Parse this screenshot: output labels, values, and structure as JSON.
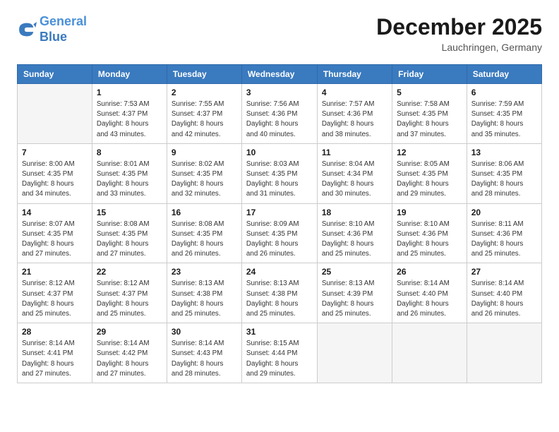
{
  "header": {
    "logo_line1": "General",
    "logo_line2": "Blue",
    "month_title": "December 2025",
    "location": "Lauchringen, Germany"
  },
  "weekdays": [
    "Sunday",
    "Monday",
    "Tuesday",
    "Wednesday",
    "Thursday",
    "Friday",
    "Saturday"
  ],
  "weeks": [
    [
      {
        "day": "",
        "info": ""
      },
      {
        "day": "1",
        "info": "Sunrise: 7:53 AM\nSunset: 4:37 PM\nDaylight: 8 hours\nand 43 minutes."
      },
      {
        "day": "2",
        "info": "Sunrise: 7:55 AM\nSunset: 4:37 PM\nDaylight: 8 hours\nand 42 minutes."
      },
      {
        "day": "3",
        "info": "Sunrise: 7:56 AM\nSunset: 4:36 PM\nDaylight: 8 hours\nand 40 minutes."
      },
      {
        "day": "4",
        "info": "Sunrise: 7:57 AM\nSunset: 4:36 PM\nDaylight: 8 hours\nand 38 minutes."
      },
      {
        "day": "5",
        "info": "Sunrise: 7:58 AM\nSunset: 4:35 PM\nDaylight: 8 hours\nand 37 minutes."
      },
      {
        "day": "6",
        "info": "Sunrise: 7:59 AM\nSunset: 4:35 PM\nDaylight: 8 hours\nand 35 minutes."
      }
    ],
    [
      {
        "day": "7",
        "info": "Sunrise: 8:00 AM\nSunset: 4:35 PM\nDaylight: 8 hours\nand 34 minutes."
      },
      {
        "day": "8",
        "info": "Sunrise: 8:01 AM\nSunset: 4:35 PM\nDaylight: 8 hours\nand 33 minutes."
      },
      {
        "day": "9",
        "info": "Sunrise: 8:02 AM\nSunset: 4:35 PM\nDaylight: 8 hours\nand 32 minutes."
      },
      {
        "day": "10",
        "info": "Sunrise: 8:03 AM\nSunset: 4:35 PM\nDaylight: 8 hours\nand 31 minutes."
      },
      {
        "day": "11",
        "info": "Sunrise: 8:04 AM\nSunset: 4:34 PM\nDaylight: 8 hours\nand 30 minutes."
      },
      {
        "day": "12",
        "info": "Sunrise: 8:05 AM\nSunset: 4:35 PM\nDaylight: 8 hours\nand 29 minutes."
      },
      {
        "day": "13",
        "info": "Sunrise: 8:06 AM\nSunset: 4:35 PM\nDaylight: 8 hours\nand 28 minutes."
      }
    ],
    [
      {
        "day": "14",
        "info": "Sunrise: 8:07 AM\nSunset: 4:35 PM\nDaylight: 8 hours\nand 27 minutes."
      },
      {
        "day": "15",
        "info": "Sunrise: 8:08 AM\nSunset: 4:35 PM\nDaylight: 8 hours\nand 27 minutes."
      },
      {
        "day": "16",
        "info": "Sunrise: 8:08 AM\nSunset: 4:35 PM\nDaylight: 8 hours\nand 26 minutes."
      },
      {
        "day": "17",
        "info": "Sunrise: 8:09 AM\nSunset: 4:35 PM\nDaylight: 8 hours\nand 26 minutes."
      },
      {
        "day": "18",
        "info": "Sunrise: 8:10 AM\nSunset: 4:36 PM\nDaylight: 8 hours\nand 25 minutes."
      },
      {
        "day": "19",
        "info": "Sunrise: 8:10 AM\nSunset: 4:36 PM\nDaylight: 8 hours\nand 25 minutes."
      },
      {
        "day": "20",
        "info": "Sunrise: 8:11 AM\nSunset: 4:36 PM\nDaylight: 8 hours\nand 25 minutes."
      }
    ],
    [
      {
        "day": "21",
        "info": "Sunrise: 8:12 AM\nSunset: 4:37 PM\nDaylight: 8 hours\nand 25 minutes."
      },
      {
        "day": "22",
        "info": "Sunrise: 8:12 AM\nSunset: 4:37 PM\nDaylight: 8 hours\nand 25 minutes."
      },
      {
        "day": "23",
        "info": "Sunrise: 8:13 AM\nSunset: 4:38 PM\nDaylight: 8 hours\nand 25 minutes."
      },
      {
        "day": "24",
        "info": "Sunrise: 8:13 AM\nSunset: 4:38 PM\nDaylight: 8 hours\nand 25 minutes."
      },
      {
        "day": "25",
        "info": "Sunrise: 8:13 AM\nSunset: 4:39 PM\nDaylight: 8 hours\nand 25 minutes."
      },
      {
        "day": "26",
        "info": "Sunrise: 8:14 AM\nSunset: 4:40 PM\nDaylight: 8 hours\nand 26 minutes."
      },
      {
        "day": "27",
        "info": "Sunrise: 8:14 AM\nSunset: 4:40 PM\nDaylight: 8 hours\nand 26 minutes."
      }
    ],
    [
      {
        "day": "28",
        "info": "Sunrise: 8:14 AM\nSunset: 4:41 PM\nDaylight: 8 hours\nand 27 minutes."
      },
      {
        "day": "29",
        "info": "Sunrise: 8:14 AM\nSunset: 4:42 PM\nDaylight: 8 hours\nand 27 minutes."
      },
      {
        "day": "30",
        "info": "Sunrise: 8:14 AM\nSunset: 4:43 PM\nDaylight: 8 hours\nand 28 minutes."
      },
      {
        "day": "31",
        "info": "Sunrise: 8:15 AM\nSunset: 4:44 PM\nDaylight: 8 hours\nand 29 minutes."
      },
      {
        "day": "",
        "info": ""
      },
      {
        "day": "",
        "info": ""
      },
      {
        "day": "",
        "info": ""
      }
    ]
  ]
}
